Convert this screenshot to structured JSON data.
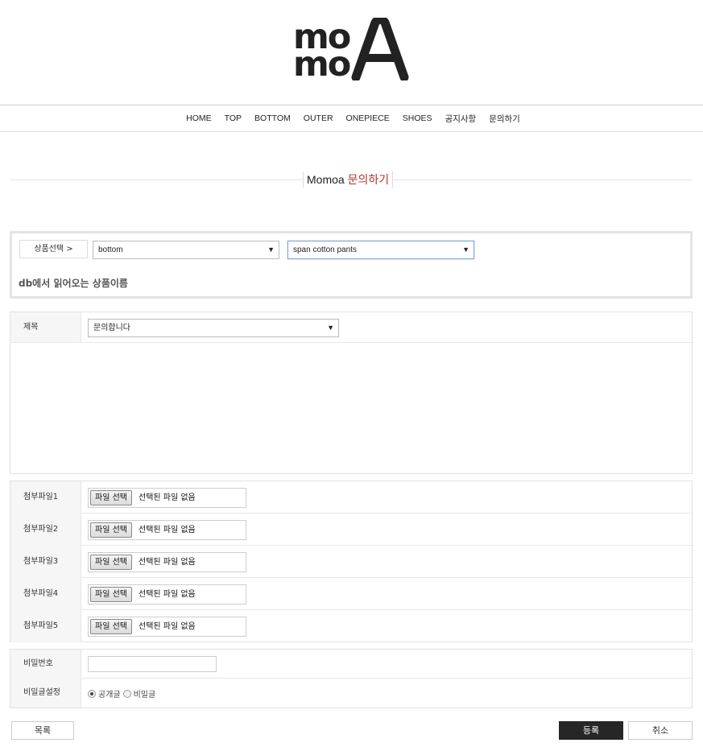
{
  "logo": {
    "line1": "mo",
    "line2": "mo",
    "big": "A"
  },
  "nav": [
    "HOME",
    "TOP",
    "BOTTOM",
    "OUTER",
    "ONEPIECE",
    "SHOES",
    "공지사항",
    "문의하기"
  ],
  "page_title": {
    "brand": "Momoa",
    "sub": "문의하기"
  },
  "product": {
    "label": "상품선택 >",
    "category_value": "bottom",
    "product_value": "span cotton pants",
    "name_text": "db에서 읽어오는 상품이름"
  },
  "subject": {
    "label": "제목",
    "value": "문의합니다"
  },
  "attachments": {
    "button_label": "파일 선택",
    "empty_text": "선택된 파일 없음",
    "rows": [
      "첨부파일1",
      "첨부파일2",
      "첨부파일3",
      "첨부파일4",
      "첨부파일5"
    ]
  },
  "password": {
    "label": "비밀번호"
  },
  "secret": {
    "label": "비밀글설정",
    "opt_public": "공개글",
    "opt_secret": "비밀글"
  },
  "buttons": {
    "list": "목록",
    "submit": "등록",
    "cancel": "취소"
  }
}
